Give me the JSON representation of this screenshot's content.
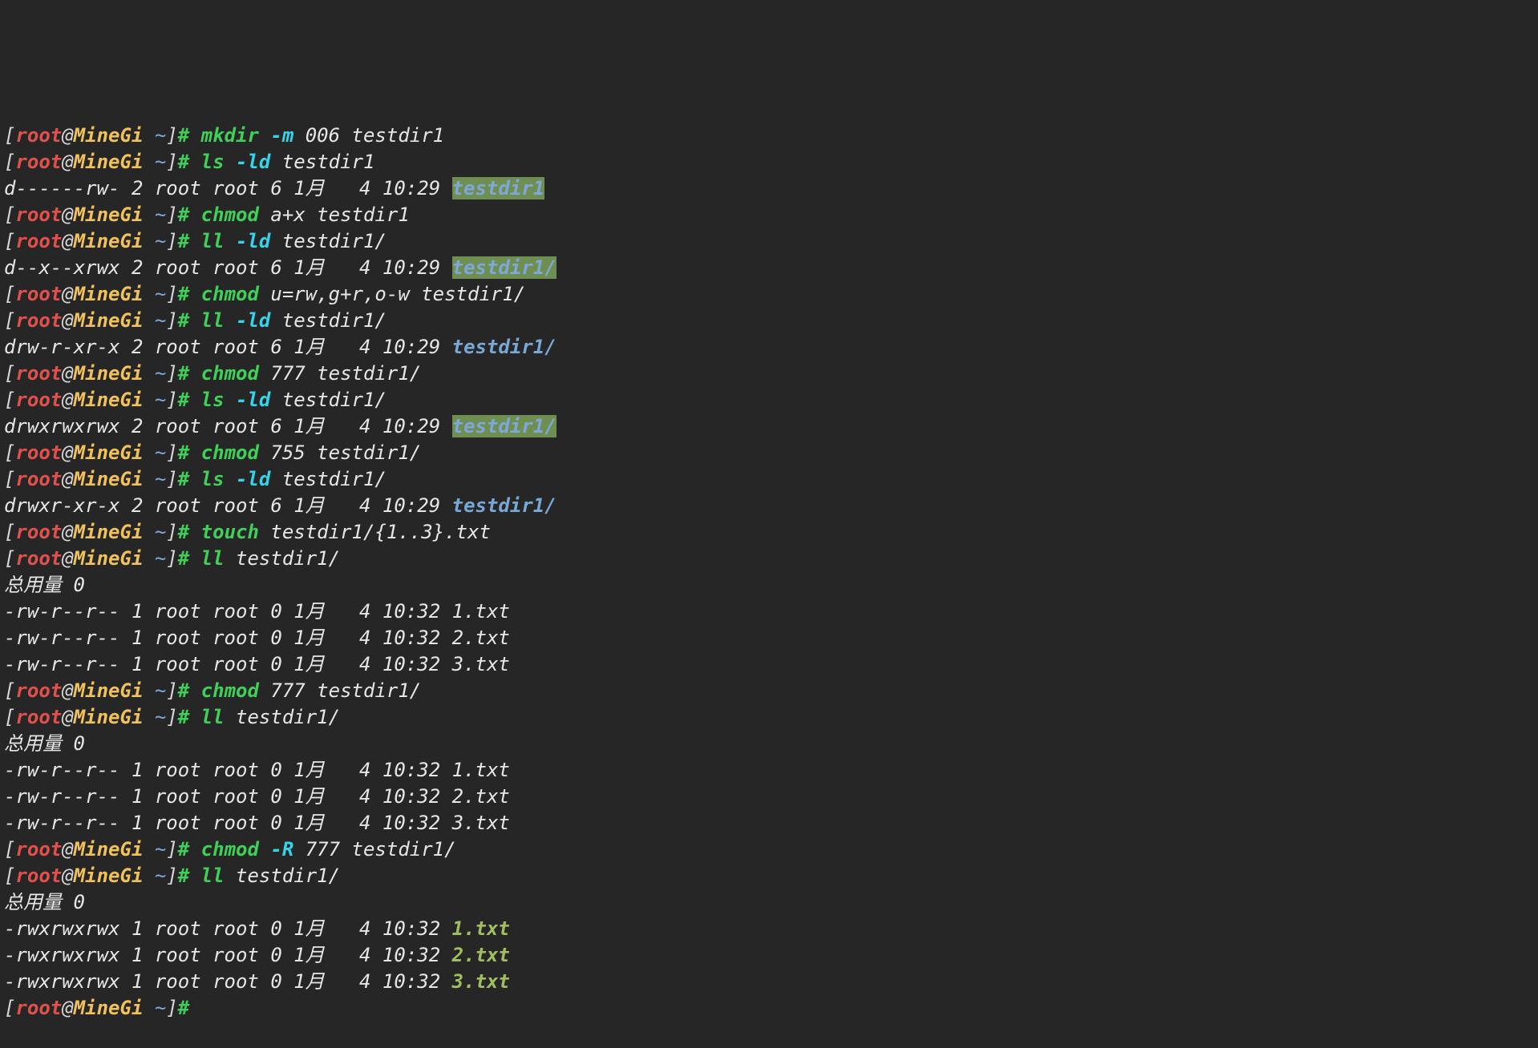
{
  "prompt": {
    "open": "[",
    "user": "root",
    "at": "@",
    "host": "MineGi",
    "path": " ~",
    "close": "]",
    "symbol": "#"
  },
  "lines": [
    {
      "t": "p",
      "c": "mkdir",
      "o": "-m",
      "a": " 006 testdir1"
    },
    {
      "t": "p",
      "c": "ls",
      "o": "-ld",
      "a": " testdir1"
    },
    {
      "t": "o",
      "text": "d------rw- 2 root root 6 1月   4 10:29 ",
      "name": "testdir1",
      "style": "hl"
    },
    {
      "t": "p",
      "c": "chmod",
      "a": " a+x testdir1"
    },
    {
      "t": "p",
      "c": "ll",
      "o": "-ld",
      "a": " testdir1/"
    },
    {
      "t": "o",
      "text": "d--x--xrwx 2 root root 6 1月   4 10:29 ",
      "name": "testdir1/",
      "style": "hl"
    },
    {
      "t": "p",
      "c": "chmod",
      "a": " u=rw,g+r,o-w testdir1/"
    },
    {
      "t": "p",
      "c": "ll",
      "o": "-ld",
      "a": " testdir1/"
    },
    {
      "t": "o",
      "text": "drw-r-xr-x 2 root root 6 1月   4 10:29 ",
      "name": "testdir1/",
      "style": "bl"
    },
    {
      "t": "p",
      "c": "chmod",
      "a": " 777 testdir1/"
    },
    {
      "t": "p",
      "c": "ls",
      "o": "-ld",
      "a": " testdir1/"
    },
    {
      "t": "o",
      "text": "drwxrwxrwx 2 root root 6 1月   4 10:29 ",
      "name": "testdir1/",
      "style": "hl"
    },
    {
      "t": "p",
      "c": "chmod",
      "a": " 755 testdir1/"
    },
    {
      "t": "p",
      "c": "ls",
      "o": "-ld",
      "a": " testdir1/"
    },
    {
      "t": "o",
      "text": "drwxr-xr-x 2 root root 6 1月   4 10:29 ",
      "name": "testdir1/",
      "style": "bl"
    },
    {
      "t": "p",
      "c": "touch",
      "a": " testdir1/{1..3}.txt"
    },
    {
      "t": "p",
      "c": "ll",
      "a": " testdir1/"
    },
    {
      "t": "o",
      "text": "总用量 0"
    },
    {
      "t": "o",
      "text": "-rw-r--r-- 1 root root 0 1月   4 10:32 ",
      "name": "1.txt",
      "style": "plain"
    },
    {
      "t": "o",
      "text": "-rw-r--r-- 1 root root 0 1月   4 10:32 ",
      "name": "2.txt",
      "style": "plain"
    },
    {
      "t": "o",
      "text": "-rw-r--r-- 1 root root 0 1月   4 10:32 ",
      "name": "3.txt",
      "style": "plain"
    },
    {
      "t": "p",
      "c": "chmod",
      "a": " 777 testdir1/"
    },
    {
      "t": "p",
      "c": "ll",
      "a": " testdir1/"
    },
    {
      "t": "o",
      "text": "总用量 0"
    },
    {
      "t": "o",
      "text": "-rw-r--r-- 1 root root 0 1月   4 10:32 ",
      "name": "1.txt",
      "style": "plain"
    },
    {
      "t": "o",
      "text": "-rw-r--r-- 1 root root 0 1月   4 10:32 ",
      "name": "2.txt",
      "style": "plain"
    },
    {
      "t": "o",
      "text": "-rw-r--r-- 1 root root 0 1月   4 10:32 ",
      "name": "3.txt",
      "style": "plain"
    },
    {
      "t": "p",
      "c": "chmod",
      "o": "-R",
      "a": " 777 testdir1/"
    },
    {
      "t": "p",
      "c": "ll",
      "a": " testdir1/"
    },
    {
      "t": "o",
      "text": "总用量 0"
    },
    {
      "t": "o",
      "text": "-rwxrwxrwx 1 root root 0 1月   4 10:32 ",
      "name": "1.txt",
      "style": "exec"
    },
    {
      "t": "o",
      "text": "-rwxrwxrwx 1 root root 0 1月   4 10:32 ",
      "name": "2.txt",
      "style": "exec"
    },
    {
      "t": "o",
      "text": "-rwxrwxrwx 1 root root 0 1月   4 10:32 ",
      "name": "3.txt",
      "style": "exec"
    },
    {
      "t": "p"
    }
  ],
  "colors": {
    "background": "#262626",
    "user": "#e0504d",
    "host": "#f1c15c",
    "command": "#3fd05a",
    "option": "#35d4ea",
    "directory": "#78a9d6",
    "directory_highlight_bg": "#6e8e52",
    "executable": "#9fbf5f"
  }
}
